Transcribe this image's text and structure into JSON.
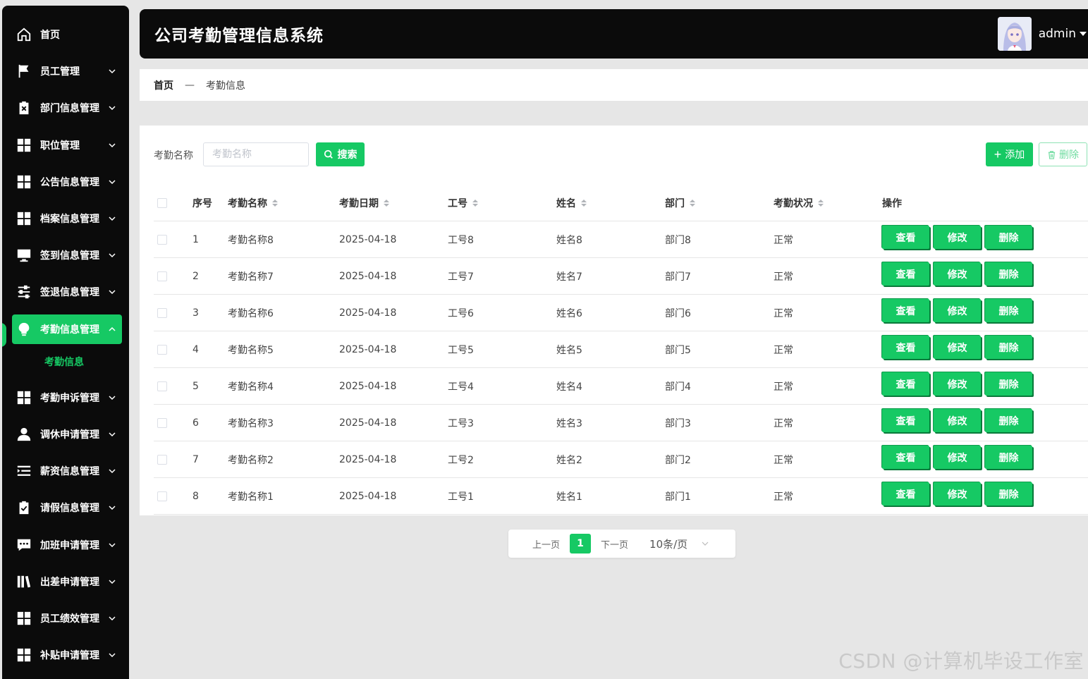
{
  "colors": {
    "accent": "#16c964",
    "dark": "#0b0b0b",
    "page_bg": "#e6e6e6"
  },
  "header": {
    "title": "公司考勤管理信息系统",
    "username": "admin"
  },
  "sidebar": {
    "items": [
      {
        "label": "首页",
        "icon": "home-icon"
      },
      {
        "label": "员工管理",
        "icon": "flag-icon"
      },
      {
        "label": "部门信息管理",
        "icon": "clipboard-x-icon"
      },
      {
        "label": "职位管理",
        "icon": "grid-icon"
      },
      {
        "label": "公告信息管理",
        "icon": "grid-icon"
      },
      {
        "label": "档案信息管理",
        "icon": "grid-icon"
      },
      {
        "label": "签到信息管理",
        "icon": "monitor-icon"
      },
      {
        "label": "签退信息管理",
        "icon": "sliders-icon"
      },
      {
        "label": "考勤信息管理",
        "icon": "bulb-icon"
      },
      {
        "label": "考勤申诉管理",
        "icon": "grid-icon"
      },
      {
        "label": "调休申请管理",
        "icon": "user-icon"
      },
      {
        "label": "薪资信息管理",
        "icon": "list-icon"
      },
      {
        "label": "请假信息管理",
        "icon": "check-clipboard-icon"
      },
      {
        "label": "加班申请管理",
        "icon": "chat-icon"
      },
      {
        "label": "出差申请管理",
        "icon": "books-icon"
      },
      {
        "label": "员工绩效管理",
        "icon": "grid-icon"
      },
      {
        "label": "补贴申请管理",
        "icon": "grid-icon"
      }
    ],
    "active_sub": "考勤信息"
  },
  "breadcrumb": {
    "home": "首页",
    "separator": "—",
    "current": "考勤信息"
  },
  "search": {
    "label": "考勤名称",
    "placeholder": "考勤名称",
    "button": "搜索"
  },
  "toolbar": {
    "add": "添加",
    "delete": "删除"
  },
  "table": {
    "headers": [
      "序号",
      "考勤名称",
      "考勤日期",
      "工号",
      "姓名",
      "部门",
      "考勤状况",
      "操作"
    ],
    "rows": [
      {
        "no": "1",
        "name": "考勤名称8",
        "date": "2025-04-18",
        "emp_no": "工号8",
        "person": "姓名8",
        "dept": "部门8",
        "status": "正常"
      },
      {
        "no": "2",
        "name": "考勤名称7",
        "date": "2025-04-18",
        "emp_no": "工号7",
        "person": "姓名7",
        "dept": "部门7",
        "status": "正常"
      },
      {
        "no": "3",
        "name": "考勤名称6",
        "date": "2025-04-18",
        "emp_no": "工号6",
        "person": "姓名6",
        "dept": "部门6",
        "status": "正常"
      },
      {
        "no": "4",
        "name": "考勤名称5",
        "date": "2025-04-18",
        "emp_no": "工号5",
        "person": "姓名5",
        "dept": "部门5",
        "status": "正常"
      },
      {
        "no": "5",
        "name": "考勤名称4",
        "date": "2025-04-18",
        "emp_no": "工号4",
        "person": "姓名4",
        "dept": "部门4",
        "status": "正常"
      },
      {
        "no": "6",
        "name": "考勤名称3",
        "date": "2025-04-18",
        "emp_no": "工号3",
        "person": "姓名3",
        "dept": "部门3",
        "status": "正常"
      },
      {
        "no": "7",
        "name": "考勤名称2",
        "date": "2025-04-18",
        "emp_no": "工号2",
        "person": "姓名2",
        "dept": "部门2",
        "status": "正常"
      },
      {
        "no": "8",
        "name": "考勤名称1",
        "date": "2025-04-18",
        "emp_no": "工号1",
        "person": "姓名1",
        "dept": "部门1",
        "status": "正常"
      }
    ],
    "actions": {
      "view": "查看",
      "edit": "修改",
      "delete": "删除"
    }
  },
  "pagination": {
    "prev": "上一页",
    "current_page": "1",
    "next": "下一页",
    "page_size": "10条/页"
  },
  "watermark": "CSDN @计算机毕设工作室"
}
